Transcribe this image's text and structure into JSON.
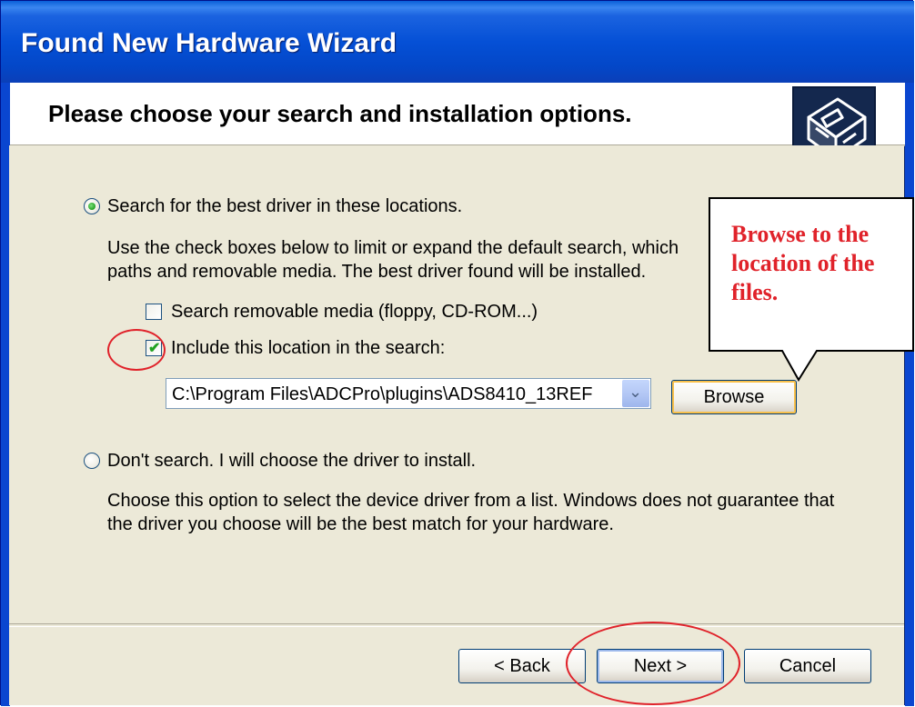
{
  "window": {
    "title": "Found New Hardware Wizard"
  },
  "header": {
    "heading": "Please choose your search and installation options."
  },
  "options": {
    "search": {
      "label": "Search for the best driver in these locations.",
      "selected": true,
      "description_line1": "Use the check boxes below to limit or expand the default search, which",
      "description_line2": "paths and removable media. The best driver found will be installed.",
      "removable_media": {
        "label": "Search removable media (floppy, CD-ROM...)",
        "checked": false
      },
      "include_location": {
        "label": "Include this location in the search:",
        "checked": true
      },
      "location_value": "C:\\Program Files\\ADCPro\\plugins\\ADS8410_13REF",
      "browse_label": "Browse"
    },
    "dont_search": {
      "label": "Don't search. I will choose the driver to install.",
      "selected": false,
      "description_line1": "Choose this option to select the device driver from a list.  Windows does not guarantee that",
      "description_line2": "the driver you choose will be the best match for your hardware."
    }
  },
  "buttons": {
    "back": "< Back",
    "next": "Next >",
    "cancel": "Cancel"
  },
  "annotation": {
    "callout_line1": "Browse to the",
    "callout_line2": "location of the",
    "callout_line3": "files.",
    "color": "#e0222a"
  }
}
